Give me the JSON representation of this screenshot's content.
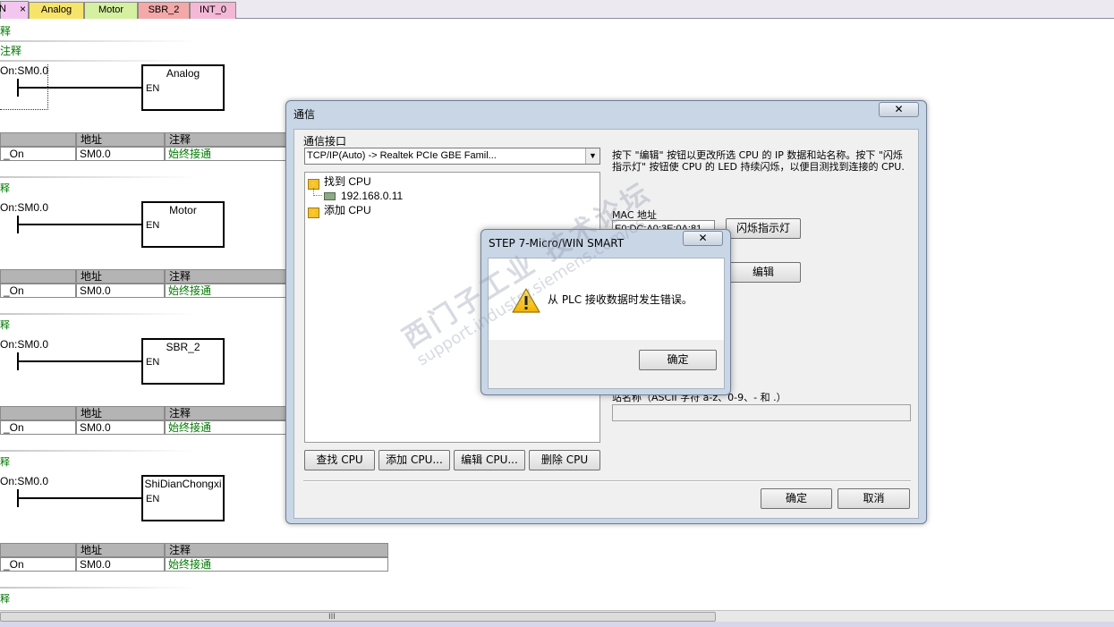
{
  "tabs": [
    {
      "label": "N"
    },
    {
      "label": "Analog"
    },
    {
      "label": "Motor"
    },
    {
      "label": "SBR_2"
    },
    {
      "label": "INT_0"
    }
  ],
  "tab_close": "×",
  "ladder": {
    "top_note": "释",
    "network_note": "注释",
    "small_note": "释",
    "networks": [
      {
        "contact": "On:SM0.0",
        "block": "Analog",
        "en": "EN"
      },
      {
        "contact": "On:SM0.0",
        "block": "Motor",
        "en": "EN"
      },
      {
        "contact": "On:SM0.0",
        "block": "SBR_2",
        "en": "EN"
      },
      {
        "contact": "On:SM0.0",
        "block": "ShiDianChongxi",
        "en": "EN"
      }
    ],
    "symbol_table": {
      "headers": [
        "",
        "地址",
        "注释"
      ],
      "row": [
        "_On",
        "SM0.0",
        "始终接通"
      ]
    },
    "scroll_grip": "III"
  },
  "comm_dialog": {
    "title": "通信",
    "close_glyph": "✕",
    "interface_label": "通信接口",
    "interface_value": "TCP/IP(Auto) -> Realtek PCIe GBE Famil...",
    "tree": {
      "found_cpu": "找到 CPU",
      "ip": "192.168.0.11",
      "add_cpu": "添加 CPU"
    },
    "description": "按下 \"编辑\" 按钮以更改所选 CPU 的 IP 数据和站名称。按下 \"闪烁指示灯\" 按钮使 CPU 的 LED 持续闪烁，以便目测找到连接的 CPU.",
    "mac_label": "MAC 地址",
    "mac_value": "E0:DC:A0:3E:0A:81",
    "blink_button": "闪烁指示灯",
    "edit_button": "编辑",
    "station_label": "站名称（ASCII 字符 a-z、0-9、- 和 .）",
    "buttons": {
      "find": "查找 CPU",
      "add": "添加 CPU...",
      "edit": "编辑 CPU...",
      "delete": "删除 CPU",
      "ok": "确定",
      "cancel": "取消"
    }
  },
  "message_box": {
    "title": "STEP 7-Micro/WIN SMART",
    "close_glyph": "✕",
    "text": "从 PLC 接收数据时发生错误。",
    "ok": "确定"
  },
  "watermark": {
    "cn": "西门子工业  技术论坛",
    "url": "support.industry.siemens.com/cs"
  },
  "colors": {
    "green_comment": "#007a00",
    "dialog_frame": "#c9d6e6",
    "tab_analog": "#f6e36a",
    "tab_motor": "#d4f0a0",
    "tab_sbr2": "#f5a8a8",
    "tab_int0": "#f3b8d6"
  }
}
